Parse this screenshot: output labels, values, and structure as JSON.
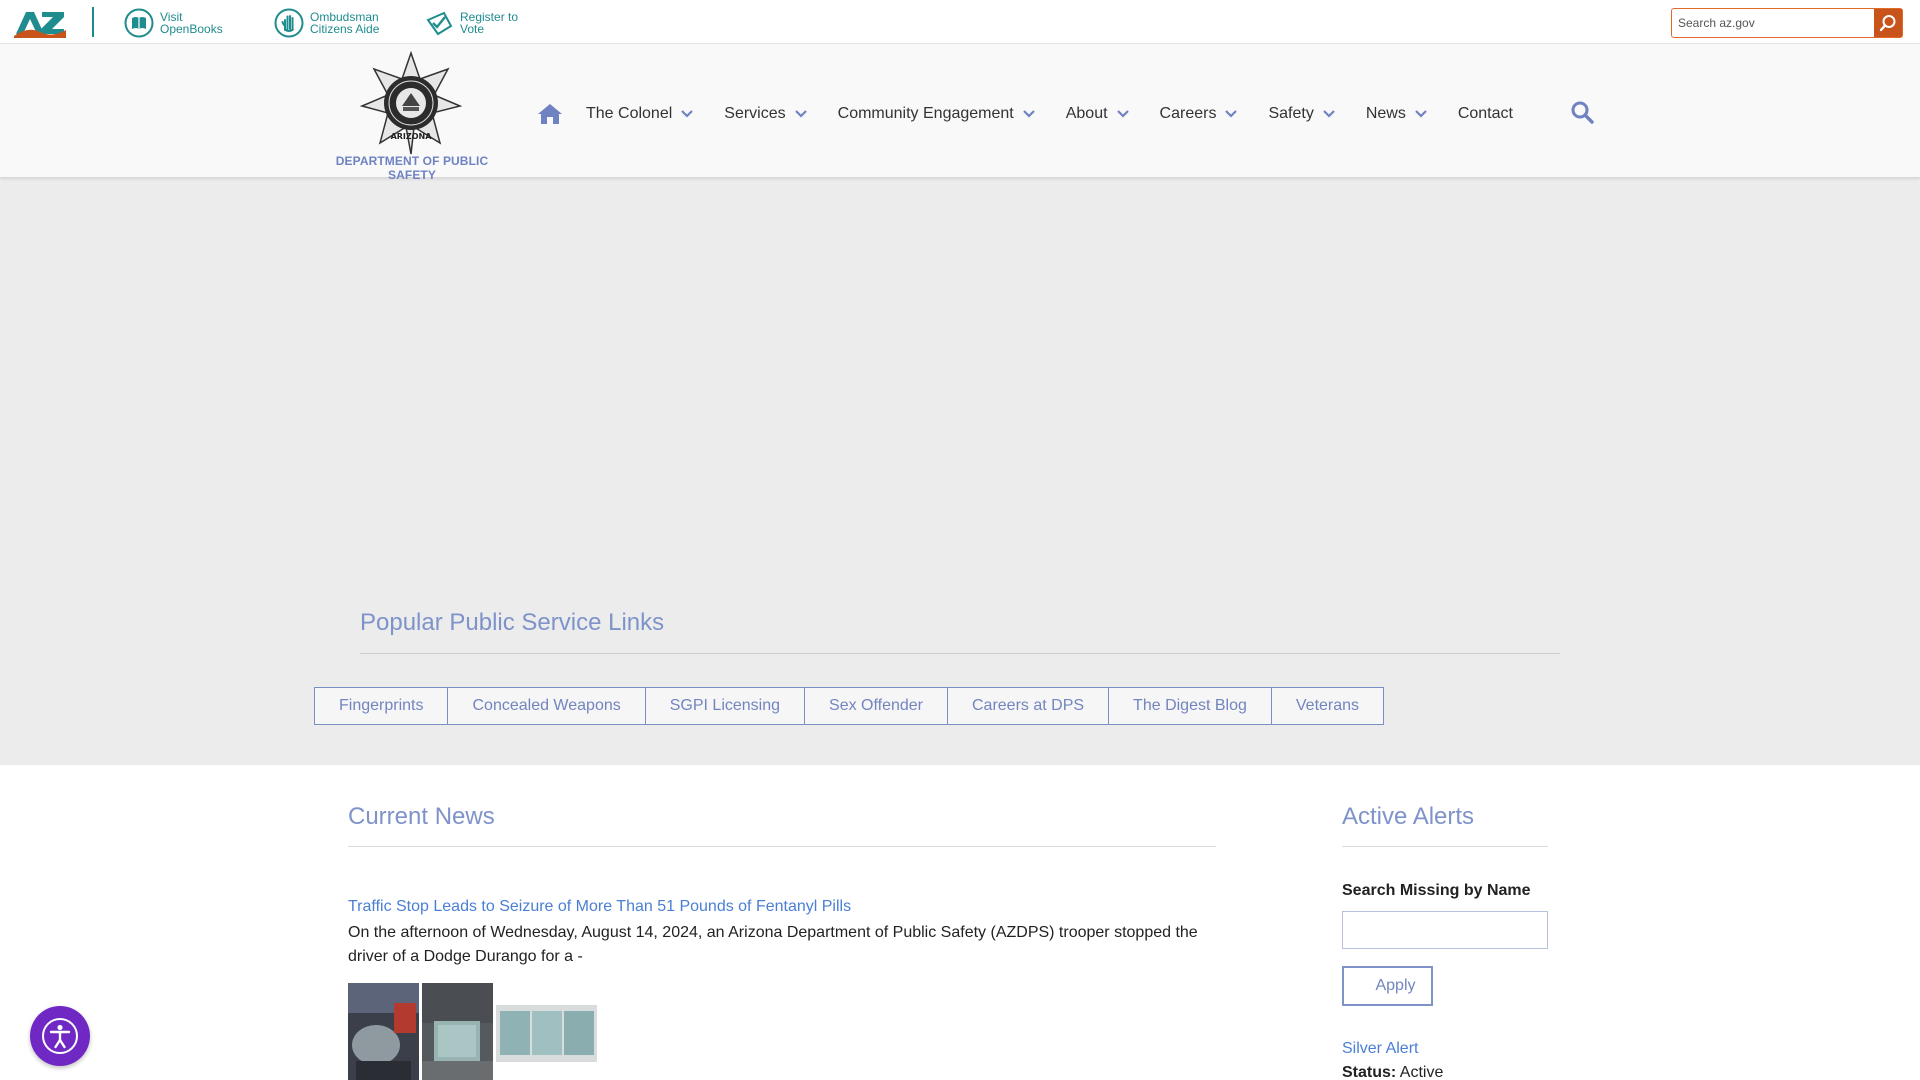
{
  "az_bar": {
    "logo_text": "AZ",
    "links": [
      {
        "line1": "Visit",
        "line2": "OpenBooks",
        "icon": "book-icon"
      },
      {
        "line1": "Ombudsman",
        "line2": "Citizens Aide",
        "icon": "hand-icon"
      },
      {
        "line1": "Register to",
        "line2": "Vote",
        "icon": "vote-check-icon"
      }
    ],
    "search_placeholder": "Search az.gov",
    "accent_color": "#1f8c8e",
    "search_accent": "#c8541c"
  },
  "header": {
    "agency_name": "DEPARTMENT OF PUBLIC SAFETY",
    "badge_text": "ARIZONA",
    "nav": [
      {
        "label": "The Colonel",
        "dropdown": true
      },
      {
        "label": "Services",
        "dropdown": true
      },
      {
        "label": "Community Engagement",
        "dropdown": true
      },
      {
        "label": "About",
        "dropdown": true
      },
      {
        "label": "Careers",
        "dropdown": true
      },
      {
        "label": "Safety",
        "dropdown": true
      },
      {
        "label": "News",
        "dropdown": true
      },
      {
        "label": "Contact",
        "dropdown": false
      }
    ],
    "brand_color": "#6f82c2"
  },
  "popular": {
    "title": "Popular Public Service Links",
    "links": [
      "Fingerprints",
      "Concealed Weapons",
      "SGPI Licensing",
      "Sex Offender",
      "Careers at DPS",
      "The Digest Blog",
      "Veterans"
    ]
  },
  "news": {
    "title": "Current News",
    "headline": "Traffic Stop Leads to Seizure of More Than 51 Pounds of Fentanyl Pills",
    "body_line1": "On the afternoon of Wednesday, August 14, 2024, an Arizona Department of Public Safety (AZDPS) trooper stopped the",
    "body_line2": "driver of a Dodge Durango for a -"
  },
  "alerts": {
    "title": "Active Alerts",
    "search_label": "Search Missing by Name",
    "apply_label": "Apply",
    "alert_name": "Silver Alert",
    "status_label": "Status:",
    "status_value": "Active"
  }
}
